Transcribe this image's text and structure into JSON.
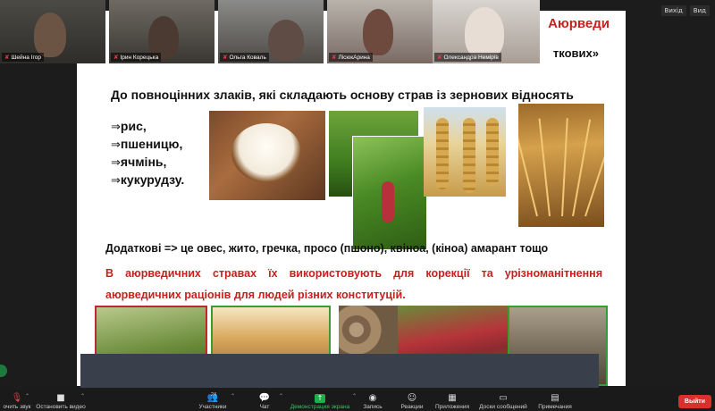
{
  "view_buttons": [
    "Вихід",
    "Вид"
  ],
  "participants_tiles": [
    {
      "name": "Шейна Ігор"
    },
    {
      "name": "Ірин Корецька"
    },
    {
      "name": "Ольга Коваль"
    },
    {
      "name": "ЛісюкАрина"
    },
    {
      "name": "Олександра Немірів"
    }
  ],
  "slide": {
    "title_fragment": "Аюрведи",
    "subtitle_fragment": "ткових»",
    "intro": "До повноцінних злаків, які складають основу страв із зернових відносять",
    "grains": [
      "рис,",
      "пшеницю,",
      "ячмінь,",
      "кукурудзу."
    ],
    "arrow_symbol": "⇒",
    "additional": "Додаткові =>  це овес, жито, гречка, просо (пшоно), квіноа, (кіноа) амарант тощо",
    "red_text": "В аюрведичних стравах їх використовують для корекції та урізноманітнення аюрведичних раціонів для людей різних конституцій."
  },
  "toolbar": {
    "items": [
      {
        "label": "очить звук",
        "icon": "mic-off-icon"
      },
      {
        "label": "Остановить видео",
        "icon": "video-icon"
      },
      {
        "label": "Участники",
        "icon": "participants-icon",
        "count": "24"
      },
      {
        "label": "Чат",
        "icon": "chat-icon"
      },
      {
        "label": "Демонстрация экрана",
        "icon": "share-screen-icon"
      },
      {
        "label": "Запись",
        "icon": "record-icon"
      },
      {
        "label": "Реакции",
        "icon": "reactions-icon"
      },
      {
        "label": "Приложения",
        "icon": "apps-icon"
      },
      {
        "label": "Доски сообщений",
        "icon": "whiteboard-icon"
      },
      {
        "label": "Примечания",
        "icon": "notes-icon"
      }
    ],
    "leave_label": "Выйти"
  },
  "colors": {
    "accent_red": "#c8201f",
    "share_green": "#1fae4a",
    "leave_red": "#d9302e"
  }
}
